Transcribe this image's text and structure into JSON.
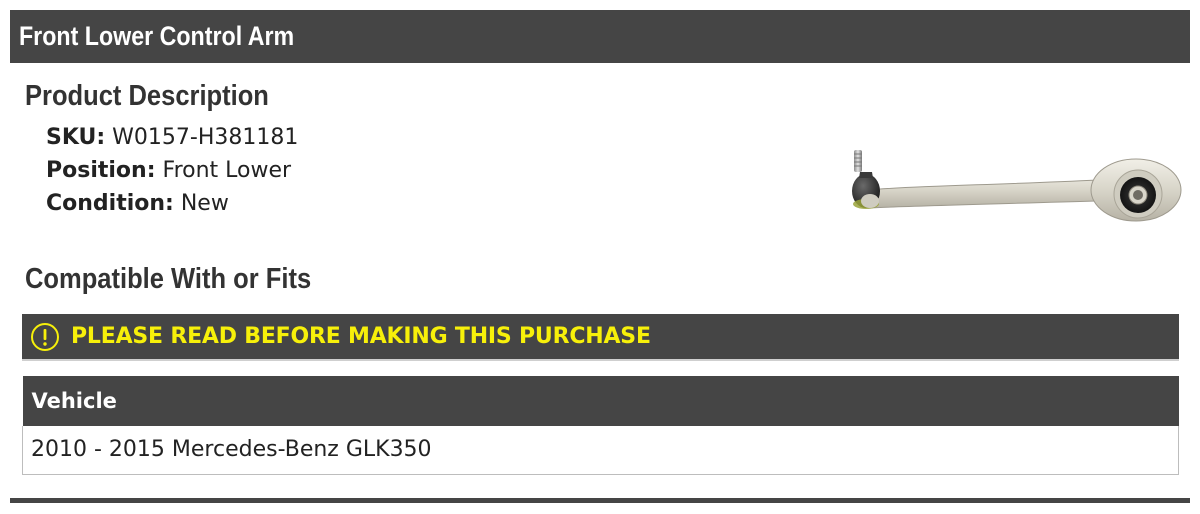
{
  "header": {
    "title": "Front Lower Control Arm"
  },
  "description": {
    "heading": "Product Description",
    "specs": [
      {
        "label": "SKU:",
        "value": "W0157-H381181"
      },
      {
        "label": "Position:",
        "value": "Front Lower"
      },
      {
        "label": "Condition:",
        "value": "New"
      }
    ]
  },
  "image": {
    "icon": "control-arm-part-image"
  },
  "compatibility": {
    "heading": "Compatible With or Fits",
    "warning": {
      "icon": "exclamation-circle-icon",
      "text": "PLEASE READ BEFORE MAKING THIS PURCHASE",
      "color": "#f7f00a"
    },
    "table": {
      "header": "Vehicle",
      "rows": [
        "2010 - 2015 Mercedes-Benz GLK350"
      ]
    }
  },
  "colors": {
    "bar": "#454545",
    "warning_text": "#f7f00a"
  }
}
